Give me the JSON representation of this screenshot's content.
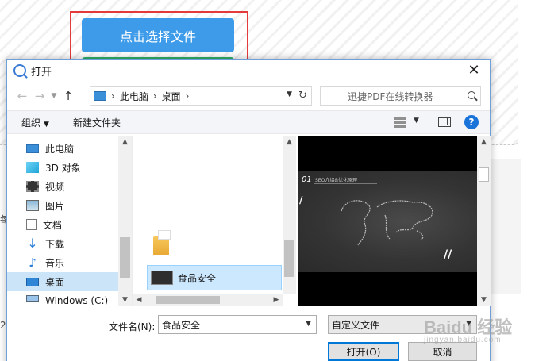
{
  "background": {
    "select_button_label": "点击选择文件",
    "left_text_1": "每",
    "left_text_2": "2"
  },
  "dialog": {
    "title": "打开",
    "close_glyph": "✕",
    "address": {
      "crumbs": [
        "此电脑",
        "桌面"
      ],
      "sep": "›"
    },
    "search_placeholder": "迅捷PDF在线转换器",
    "toolbar": {
      "organize": "组织",
      "new_folder": "新建文件夹",
      "help": "?"
    },
    "nav_items": [
      {
        "label": "此电脑",
        "icon": "computer-icon"
      },
      {
        "label": "3D 对象",
        "icon": "cube-icon"
      },
      {
        "label": "视频",
        "icon": "video-icon"
      },
      {
        "label": "图片",
        "icon": "picture-icon"
      },
      {
        "label": "文档",
        "icon": "document-icon"
      },
      {
        "label": "下载",
        "icon": "download-icon"
      },
      {
        "label": "音乐",
        "icon": "music-icon"
      },
      {
        "label": "桌面",
        "icon": "desktop-icon"
      },
      {
        "label": "Windows (C:)",
        "icon": "drive-icon"
      }
    ],
    "selected_nav_index": 7,
    "files": [
      {
        "name": "食品安全",
        "selected": true
      }
    ],
    "stray_mark": "i",
    "preview": {
      "slide_number": "01",
      "slide_title": "SEO介绍&优化原理"
    },
    "footer": {
      "filename_label": "文件名(N):",
      "filename_value": "食品安全",
      "filetype_value": "自定义文件",
      "open_button": "打开(O)",
      "cancel_button": "取消"
    }
  },
  "watermark": {
    "text": "Baidu 经验",
    "sub": "jingyan.baidu.com"
  },
  "colors": {
    "select_button": "#3d9be9",
    "highlight_box": "#e33b3b",
    "selection": "#cce4f7",
    "accent": "#0078d7"
  }
}
